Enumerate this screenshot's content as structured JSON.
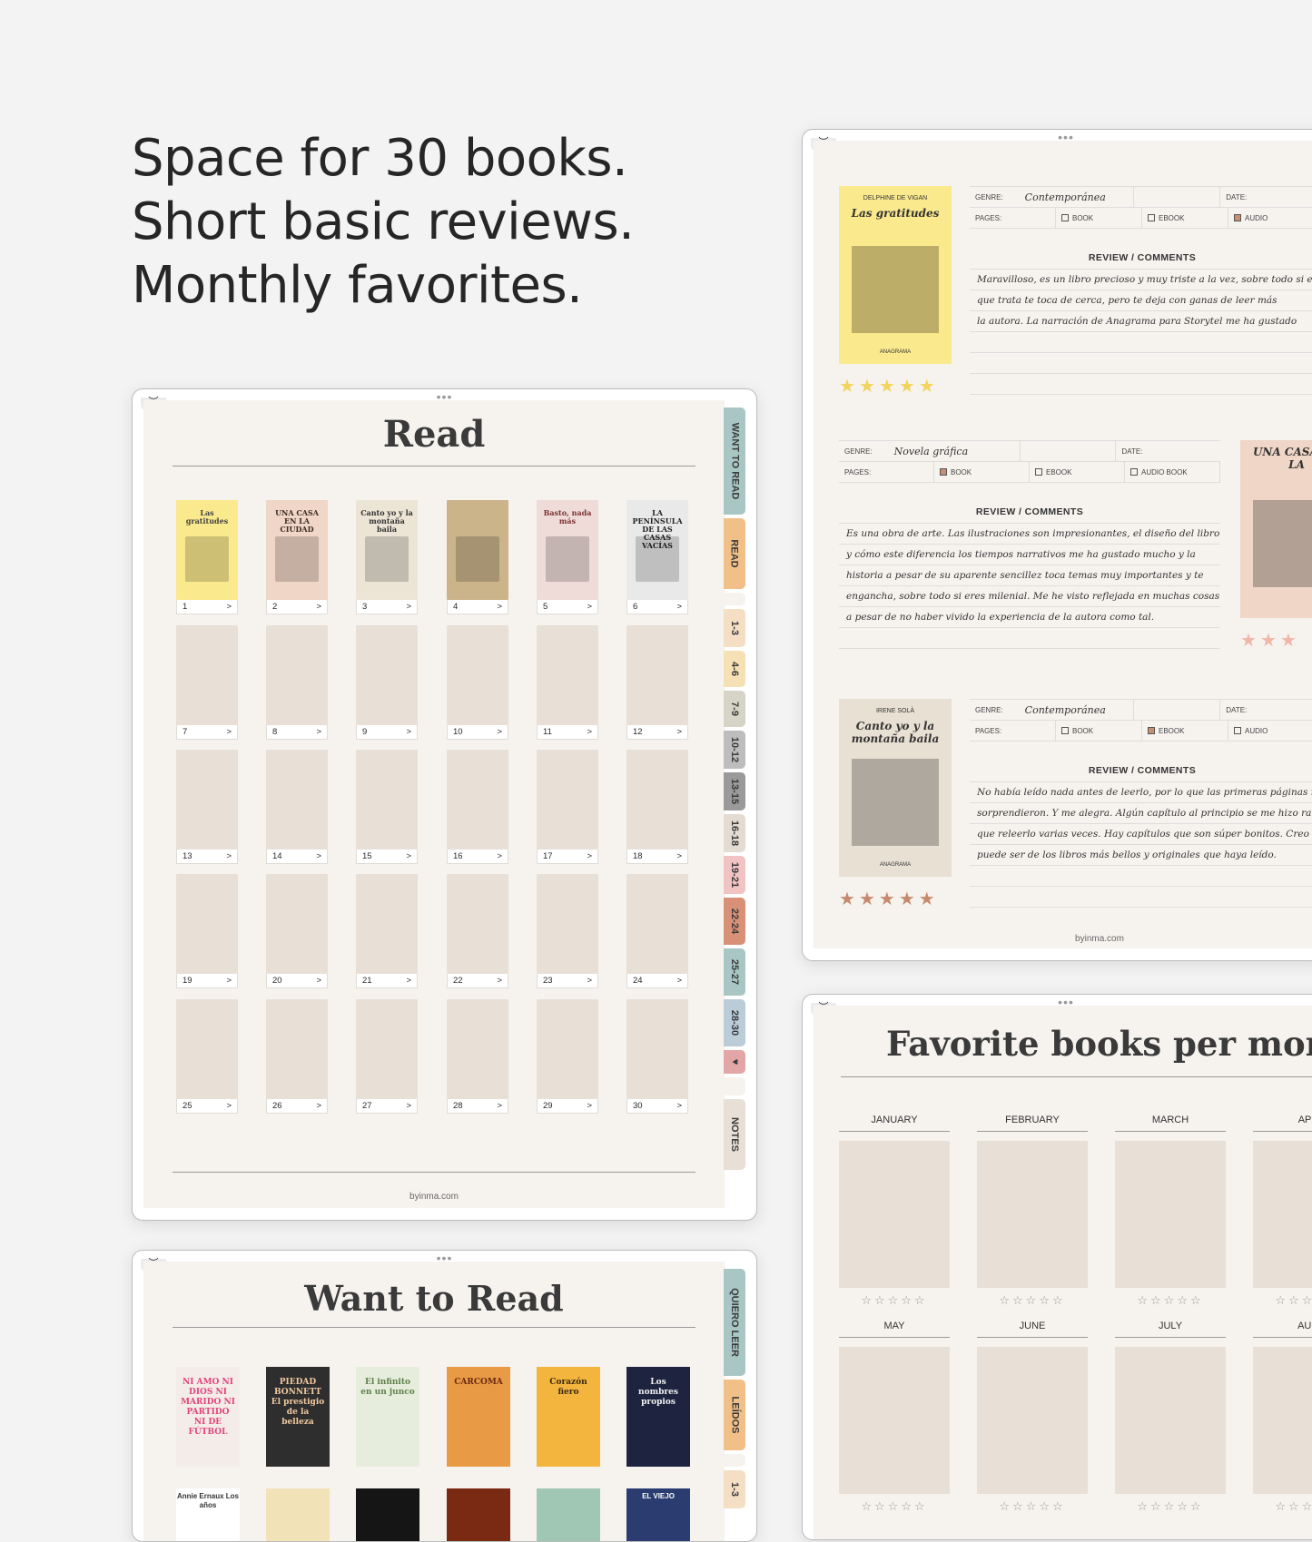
{
  "headline": [
    "Space for 30 books.",
    "Short basic reviews.",
    "Monthly favorites."
  ],
  "read_page": {
    "title": "Read",
    "footer": "byinma.com",
    "tabs": [
      {
        "label": "WANT TO READ",
        "color": "#a8c7c4",
        "h": 118
      },
      {
        "label": "READ",
        "color": "#f1c089",
        "h": 78
      },
      {
        "label": "",
        "color": "#f6f3ef",
        "h": 14
      },
      {
        "label": "1-3",
        "color": "#f4dfc4",
        "h": 42
      },
      {
        "label": "4-6",
        "color": "#f6e1b5",
        "h": 40
      },
      {
        "label": "7-9",
        "color": "#d6d4c7",
        "h": 40
      },
      {
        "label": "10-12",
        "color": "#bdbdbd",
        "h": 42
      },
      {
        "label": "13-15",
        "color": "#9a9a9a",
        "h": 42
      },
      {
        "label": "16-18",
        "color": "#e4dcd3",
        "h": 42
      },
      {
        "label": "19-21",
        "color": "#f1c3c3",
        "h": 42
      },
      {
        "label": "22-24",
        "color": "#d89177",
        "h": 52
      },
      {
        "label": "25-27",
        "color": "#a8c7c4",
        "h": 52
      },
      {
        "label": "28-30",
        "color": "#b9ccd8",
        "h": 52
      },
      {
        "label": "♥",
        "color": "#e3a6a6",
        "h": 26
      },
      {
        "label": "",
        "color": "#f6f3ef",
        "h": 20
      },
      {
        "label": "NOTES",
        "color": "#e8dfd7",
        "h": 78
      }
    ],
    "books": [
      {
        "n": "1",
        "arrow": ">",
        "cover": "Las gratitudes",
        "bg": "#fbe98d",
        "fg": "#444"
      },
      {
        "n": "2",
        "arrow": ">",
        "cover": "UNA CASA EN LA CIUDAD",
        "bg": "#efd6c6",
        "fg": "#3b2a22"
      },
      {
        "n": "3",
        "arrow": ">",
        "cover": "Canto yo y la montaña baila",
        "bg": "#ece5d6",
        "fg": "#333"
      },
      {
        "n": "4",
        "arrow": ">",
        "cover": "",
        "bg": "#cbb48a",
        "fg": "#3b2d16"
      },
      {
        "n": "5",
        "arrow": ">",
        "cover": "Basto, nada más",
        "bg": "#efdcd8",
        "fg": "#7b3333"
      },
      {
        "n": "6",
        "arrow": ">",
        "cover": "LA PENÍNSULA DE LAS CASAS VACÍAS",
        "bg": "#e9e9e9",
        "fg": "#222"
      },
      {
        "n": "7",
        "arrow": ">"
      },
      {
        "n": "8",
        "arrow": ">"
      },
      {
        "n": "9",
        "arrow": ">"
      },
      {
        "n": "10",
        "arrow": ">"
      },
      {
        "n": "11",
        "arrow": ">"
      },
      {
        "n": "12",
        "arrow": ">"
      },
      {
        "n": "13",
        "arrow": ">"
      },
      {
        "n": "14",
        "arrow": ">"
      },
      {
        "n": "15",
        "arrow": ">"
      },
      {
        "n": "16",
        "arrow": ">"
      },
      {
        "n": "17",
        "arrow": ">"
      },
      {
        "n": "18",
        "arrow": ">"
      },
      {
        "n": "19",
        "arrow": ">"
      },
      {
        "n": "20",
        "arrow": ">"
      },
      {
        "n": "21",
        "arrow": ">"
      },
      {
        "n": "22",
        "arrow": ">"
      },
      {
        "n": "23",
        "arrow": ">"
      },
      {
        "n": "24",
        "arrow": ">"
      },
      {
        "n": "25",
        "arrow": ">"
      },
      {
        "n": "26",
        "arrow": ">"
      },
      {
        "n": "27",
        "arrow": ">"
      },
      {
        "n": "28",
        "arrow": ">"
      },
      {
        "n": "29",
        "arrow": ">"
      },
      {
        "n": "30",
        "arrow": ">"
      }
    ]
  },
  "review_page": {
    "footer": "byinma.com",
    "labels": {
      "genre": "GENRE:",
      "date": "DATE:",
      "pages": "PAGES:",
      "book": "BOOK",
      "ebook": "EBOOK",
      "audio": "AUDIO BOOK",
      "audio_short": "AUDIO",
      "review": "REVIEW / COMMENTS"
    },
    "entries": [
      {
        "cover_author": "DELPHINE DE VIGAN",
        "cover_title": "Las gratitudes",
        "cover_publisher": "ANAGRAMA",
        "cover_bg": "#fbe98d",
        "genre": "Contemporánea",
        "checked": "audio",
        "lines": [
          "Maravilloso, es un libro precioso y muy triste a la vez, sobre todo si el",
          "que trata te toca de cerca, pero te deja con ganas de leer más",
          "la autora. La narración de Anagrama para Storytel me ha gustado"
        ],
        "stars": 5,
        "star_color": "#f2d45c"
      },
      {
        "cover_title": "UNA CASA EN LA",
        "cover_bg": "#efd6c6",
        "genre": "Novela gráfica",
        "checked": "book",
        "lines": [
          "Es una obra de arte. Las ilustraciones son impresionantes, el diseño del libro",
          "y cómo este diferencia los tiempos narrativos me ha gustado mucho y la",
          "historia a pesar de su aparente sencillez toca temas muy importantes y te",
          "engancha, sobre todo si eres milenial. Me he visto reflejada en muchas cosas",
          "a pesar de no haber vivido la experiencia de la autora como tal."
        ],
        "stars": 3,
        "star_color": "#f0b7a8"
      },
      {
        "cover_author": "IRENE SOLÀ",
        "cover_title": "Canto yo y la montaña baila",
        "cover_publisher": "ANAGRAMA",
        "cover_bg": "#e8e0d3",
        "genre": "Contemporánea",
        "checked": "ebook",
        "lines": [
          "No había leído nada antes de leerlo, por lo que las primeras páginas me",
          "sorprendieron. Y me alegra. Algún capítulo al principio se me hizo raro",
          "que releerlo varias veces. Hay capítulos que son súper bonitos. Creo que",
          "puede ser de los libros más bellos y originales que haya leído."
        ],
        "stars": 5,
        "star_color": "#c78a6d"
      }
    ]
  },
  "favorites_page": {
    "title": "Favorite books per month",
    "months_row1": [
      "JANUARY",
      "FEBRUARY",
      "MARCH",
      "APR"
    ],
    "months_row2": [
      "MAY",
      "JUNE",
      "JULY",
      "AUG"
    ],
    "stars": "☆☆☆☆☆"
  },
  "want_page": {
    "title": "Want to Read",
    "tabs": [
      {
        "label": "QUIERO LEER",
        "color": "#a8c7c4",
        "h": 118
      },
      {
        "label": "LEÍDOS",
        "color": "#f1c089",
        "h": 78
      },
      {
        "label": "",
        "color": "#f6f3ef",
        "h": 14
      },
      {
        "label": "1-3",
        "color": "#f4dfc4",
        "h": 42
      }
    ],
    "books": [
      {
        "cover": "NI AMO NI DIOS NI MARIDO NI PARTIDO NI DE FÚTBOL",
        "bg": "#f4ece9",
        "fg": "#e0457b"
      },
      {
        "cover": "PIEDAD BONNETT El prestigio de la belleza",
        "bg": "#2e2e2e",
        "fg": "#f0c9a0"
      },
      {
        "cover": "El infinito en un junco",
        "bg": "#e7eddc",
        "fg": "#5d7f4a"
      },
      {
        "cover": "CARCOMA",
        "bg": "#e99a45",
        "fg": "#6a2a13"
      },
      {
        "cover": "Corazón fiero",
        "bg": "#f4b53f",
        "fg": "#3a2a12"
      },
      {
        "cover": "Los nombres propios",
        "bg": "#1e2440",
        "fg": "#f2f2f2"
      }
    ],
    "books_row2": [
      {
        "cover": "Annie Ernaux Los años",
        "bg": "#ffffff",
        "fg": "#333"
      },
      {
        "cover": "",
        "bg": "#f1e2b8",
        "fg": "#333"
      },
      {
        "cover": "",
        "bg": "#151515",
        "fg": "#ddd"
      },
      {
        "cover": "",
        "bg": "#7a2a12",
        "fg": "#ddd"
      },
      {
        "cover": "",
        "bg": "#9fc7b4",
        "fg": "#333"
      },
      {
        "cover": "EL VIEJO",
        "bg": "#2a3c70",
        "fg": "#fff"
      }
    ]
  }
}
